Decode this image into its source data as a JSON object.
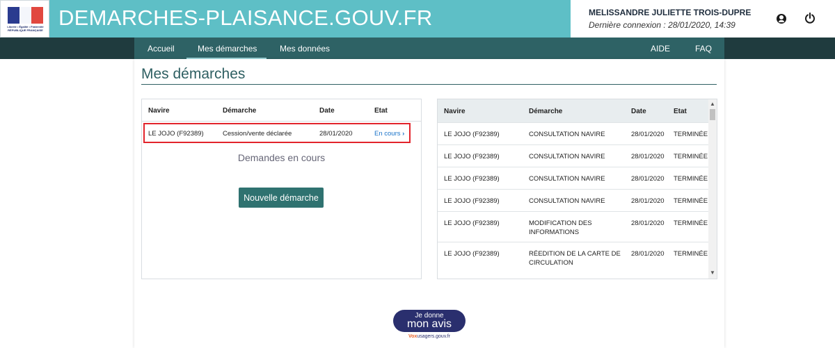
{
  "header": {
    "logo_text": "Liberté • Égalité • Fraternité RÉPUBLIQUE FRANÇAISE",
    "site_title": "DEMARCHES-PLAISANCE.GOUV.FR",
    "user_name": "MELISSANDRE JULIETTE TROIS-DUPRE",
    "last_login": "Dernière connexion : 28/01/2020, 14:39",
    "icons": [
      "user-icon",
      "power-icon"
    ]
  },
  "nav": {
    "items": [
      "Accueil",
      "Mes démarches",
      "Mes données"
    ],
    "active": "Mes démarches",
    "right_items": [
      "AIDE",
      "FAQ"
    ]
  },
  "page": {
    "title": "Mes démarches"
  },
  "current": {
    "columns": [
      "Navire",
      "Démarche",
      "Date",
      "Etat"
    ],
    "rows": [
      {
        "navire": "LE JOJO (F92389)",
        "demarche": "Cession/vente déclarée",
        "date": "28/01/2020",
        "etat": "En cours"
      }
    ],
    "pending_label": "Demandes en cours",
    "new_button": "Nouvelle démarche"
  },
  "history": {
    "columns": [
      "Navire",
      "Démarche",
      "Date",
      "Etat"
    ],
    "rows": [
      {
        "navire": "LE JOJO (F92389)",
        "demarche_l1": "CONSULTATION NAVIRE",
        "demarche_l2": "",
        "date": "28/01/2020",
        "etat": "TERMINÉE"
      },
      {
        "navire": "LE JOJO (F92389)",
        "demarche_l1": "CONSULTATION NAVIRE",
        "demarche_l2": "",
        "date": "28/01/2020",
        "etat": "TERMINÉE"
      },
      {
        "navire": "LE JOJO (F92389)",
        "demarche_l1": "CONSULTATION NAVIRE",
        "demarche_l2": "",
        "date": "28/01/2020",
        "etat": "TERMINÉE"
      },
      {
        "navire": "LE JOJO (F92389)",
        "demarche_l1": "CONSULTATION NAVIRE",
        "demarche_l2": "",
        "date": "28/01/2020",
        "etat": "TERMINÉE"
      },
      {
        "navire": "LE JOJO (F92389)",
        "demarche_l1": "MODIFICATION DES",
        "demarche_l2": "INFORMATIONS",
        "date": "28/01/2020",
        "etat": "TERMINÉE"
      },
      {
        "navire": "LE JOJO (F92389)",
        "demarche_l1": "RÉEDITION DE LA CARTE DE",
        "demarche_l2": "CIRCULATION",
        "date": "28/01/2020",
        "etat": "TERMINÉE"
      }
    ]
  },
  "feedback": {
    "line1": "Je donne",
    "line2": "mon avis",
    "sub_brand": "Vox",
    "sub_rest": "usagers.gouv.fr"
  },
  "colors": {
    "header_bg": "#5ebfc6",
    "navbar_bg": "#2e6265",
    "accent": "#2e5f62",
    "button_bg": "#2f7270",
    "highlight_border": "#e2232b",
    "link": "#1a73c9"
  }
}
